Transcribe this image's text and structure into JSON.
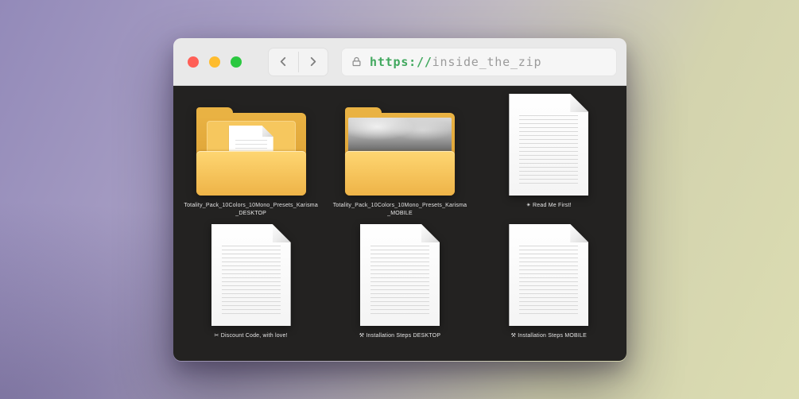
{
  "theme": {
    "traffic_red": "#ff5f57",
    "traffic_yellow": "#febc2e",
    "traffic_green": "#2bc840",
    "protocol_green": "#41a85e",
    "host_gray": "#9b9b9b",
    "panel_dark": "#232221",
    "titlebar_gray": "#e9e9e9",
    "label_white": "#e8e8e8",
    "folder_yellow": "#f3bb4e"
  },
  "browser": {
    "window_controls": [
      "close",
      "minimize",
      "zoom"
    ],
    "nav": [
      "back",
      "forward"
    ],
    "address": {
      "protocol": "https://",
      "host": "inside_the_zip"
    }
  },
  "files": [
    {
      "kind": "folder",
      "preview": "nested-documents",
      "label": "Totality_Pack_10Colors_10Mono_Presets_Karisma_DESKTOP"
    },
    {
      "kind": "folder",
      "preview": "photo-thumbnail",
      "label": "Totality_Pack_10Colors_10Mono_Presets_Karisma_MOBILE"
    },
    {
      "kind": "document",
      "label": "✴ Read Me First!"
    },
    {
      "kind": "document",
      "label": "✂ Discount Code, with love!"
    },
    {
      "kind": "document",
      "label": "⚒ Installation Steps DESKTOP"
    },
    {
      "kind": "document",
      "label": "⚒ Installation Steps MOBILE"
    }
  ]
}
